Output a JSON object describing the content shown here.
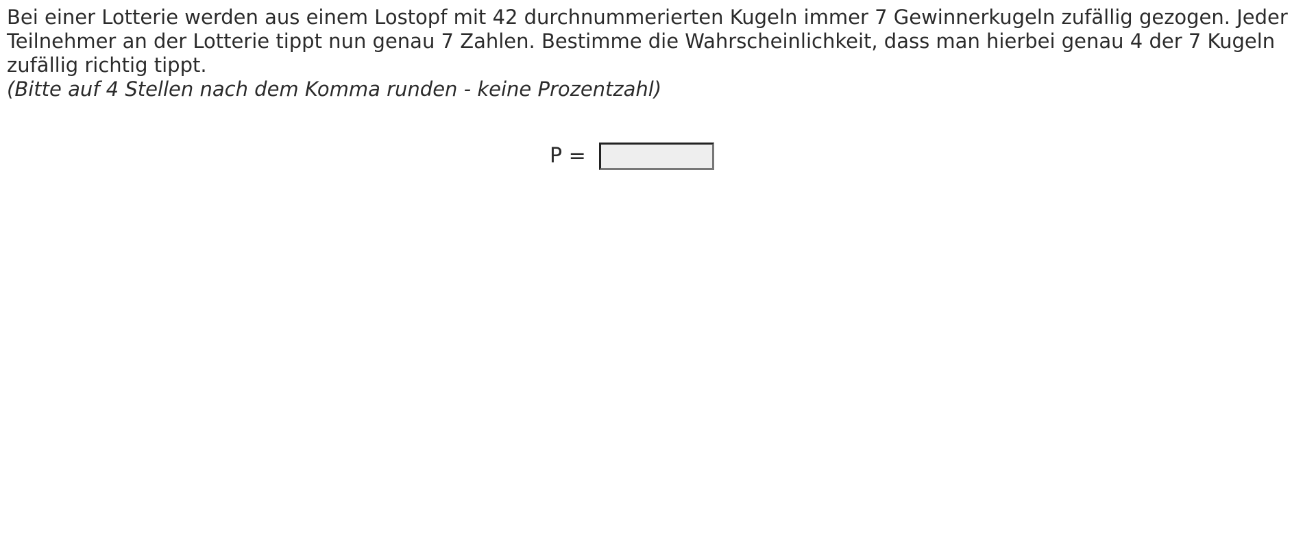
{
  "question": {
    "text": "Bei einer Lotterie werden aus einem Lostopf mit 42 durchnummerierten Kugeln immer 7 Gewinnerkugeln zufällig gezogen. Jeder Teilnehmer an der Lotterie tippt nun genau 7 Zahlen. Bestimme die Wahrscheinlichkeit, dass man hierbei genau 4 der 7 Kugeln zufällig richtig tippt.",
    "hint": "(Bitte auf 4 Stellen nach dem Komma runden - keine Prozentzahl)"
  },
  "answer": {
    "label": "P =",
    "value": "",
    "placeholder": ""
  }
}
